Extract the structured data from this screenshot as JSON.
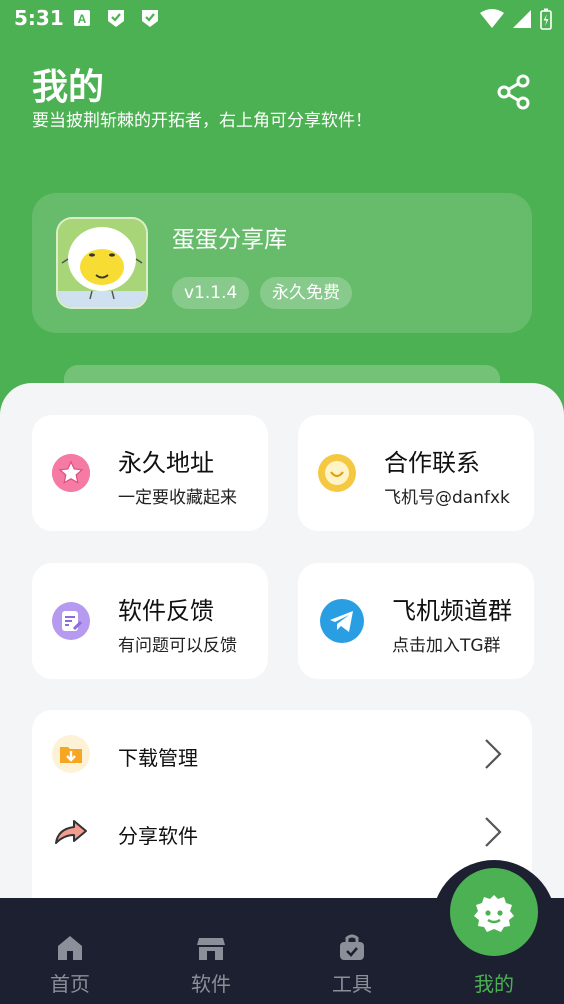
{
  "status_bar": {
    "time": "5:31"
  },
  "header": {
    "title": "我的",
    "subtitle": "要当披荆斩棘的开拓者，右上角可分享软件！"
  },
  "app_card": {
    "name": "蛋蛋分享库",
    "version": "v1.1.4",
    "tag": "永久免费"
  },
  "quick_cards": [
    {
      "title": "永久地址",
      "subtitle": "一定要收藏起来",
      "icon": "star-icon"
    },
    {
      "title": "合作联系",
      "subtitle": "飞机号@danfxk",
      "icon": "chat-bubble-icon"
    },
    {
      "title": "软件反馈",
      "subtitle": "有问题可以反馈",
      "icon": "edit-note-icon"
    },
    {
      "title": "飞机频道群",
      "subtitle": "点击加入TG群",
      "icon": "telegram-icon"
    }
  ],
  "list_items": [
    {
      "label": "下载管理",
      "icon": "download-folder-icon"
    },
    {
      "label": "分享软件",
      "icon": "share-arrow-icon"
    }
  ],
  "tab_bar": {
    "items": [
      {
        "label": "首页",
        "icon": "home-icon"
      },
      {
        "label": "软件",
        "icon": "store-icon"
      },
      {
        "label": "工具",
        "icon": "toolbox-icon"
      },
      {
        "label": "我的",
        "icon": "profile-icon"
      }
    ],
    "active_index": 3
  },
  "colors": {
    "brand_green": "#4cb152",
    "tab_bar_bg": "#1c2030",
    "inactive_tab": "#8a8f99"
  }
}
